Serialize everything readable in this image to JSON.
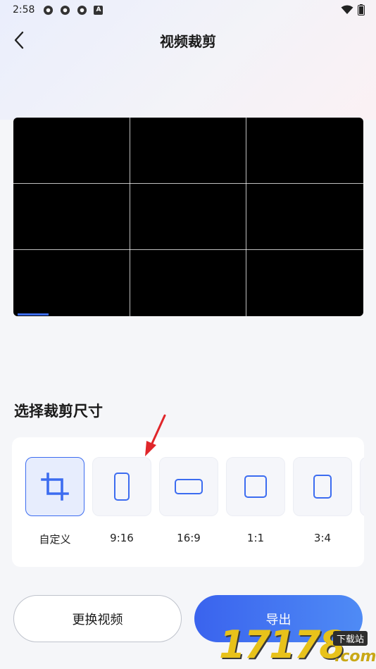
{
  "status": {
    "time": "2:58",
    "notif_icon_letter": "A"
  },
  "nav": {
    "title": "视频裁剪"
  },
  "section": {
    "title": "选择裁剪尺寸"
  },
  "ratios": [
    {
      "label": "自定义",
      "icon": "crop-icon",
      "active": true
    },
    {
      "label": "9:16",
      "icon": "portrait-ratio-icon",
      "active": false
    },
    {
      "label": "16:9",
      "icon": "landscape-ratio-icon",
      "active": false
    },
    {
      "label": "1:1",
      "icon": "square-ratio-icon",
      "active": false
    },
    {
      "label": "3:4",
      "icon": "portrait-ratio-icon",
      "active": false
    }
  ],
  "buttons": {
    "change_video": "更换视频",
    "export": "导出"
  },
  "watermark": {
    "number": "17178",
    "tag": "下载站",
    "domain": ".com"
  },
  "colors": {
    "accent": "#3c6cf0",
    "arrow": "#e0262a"
  }
}
